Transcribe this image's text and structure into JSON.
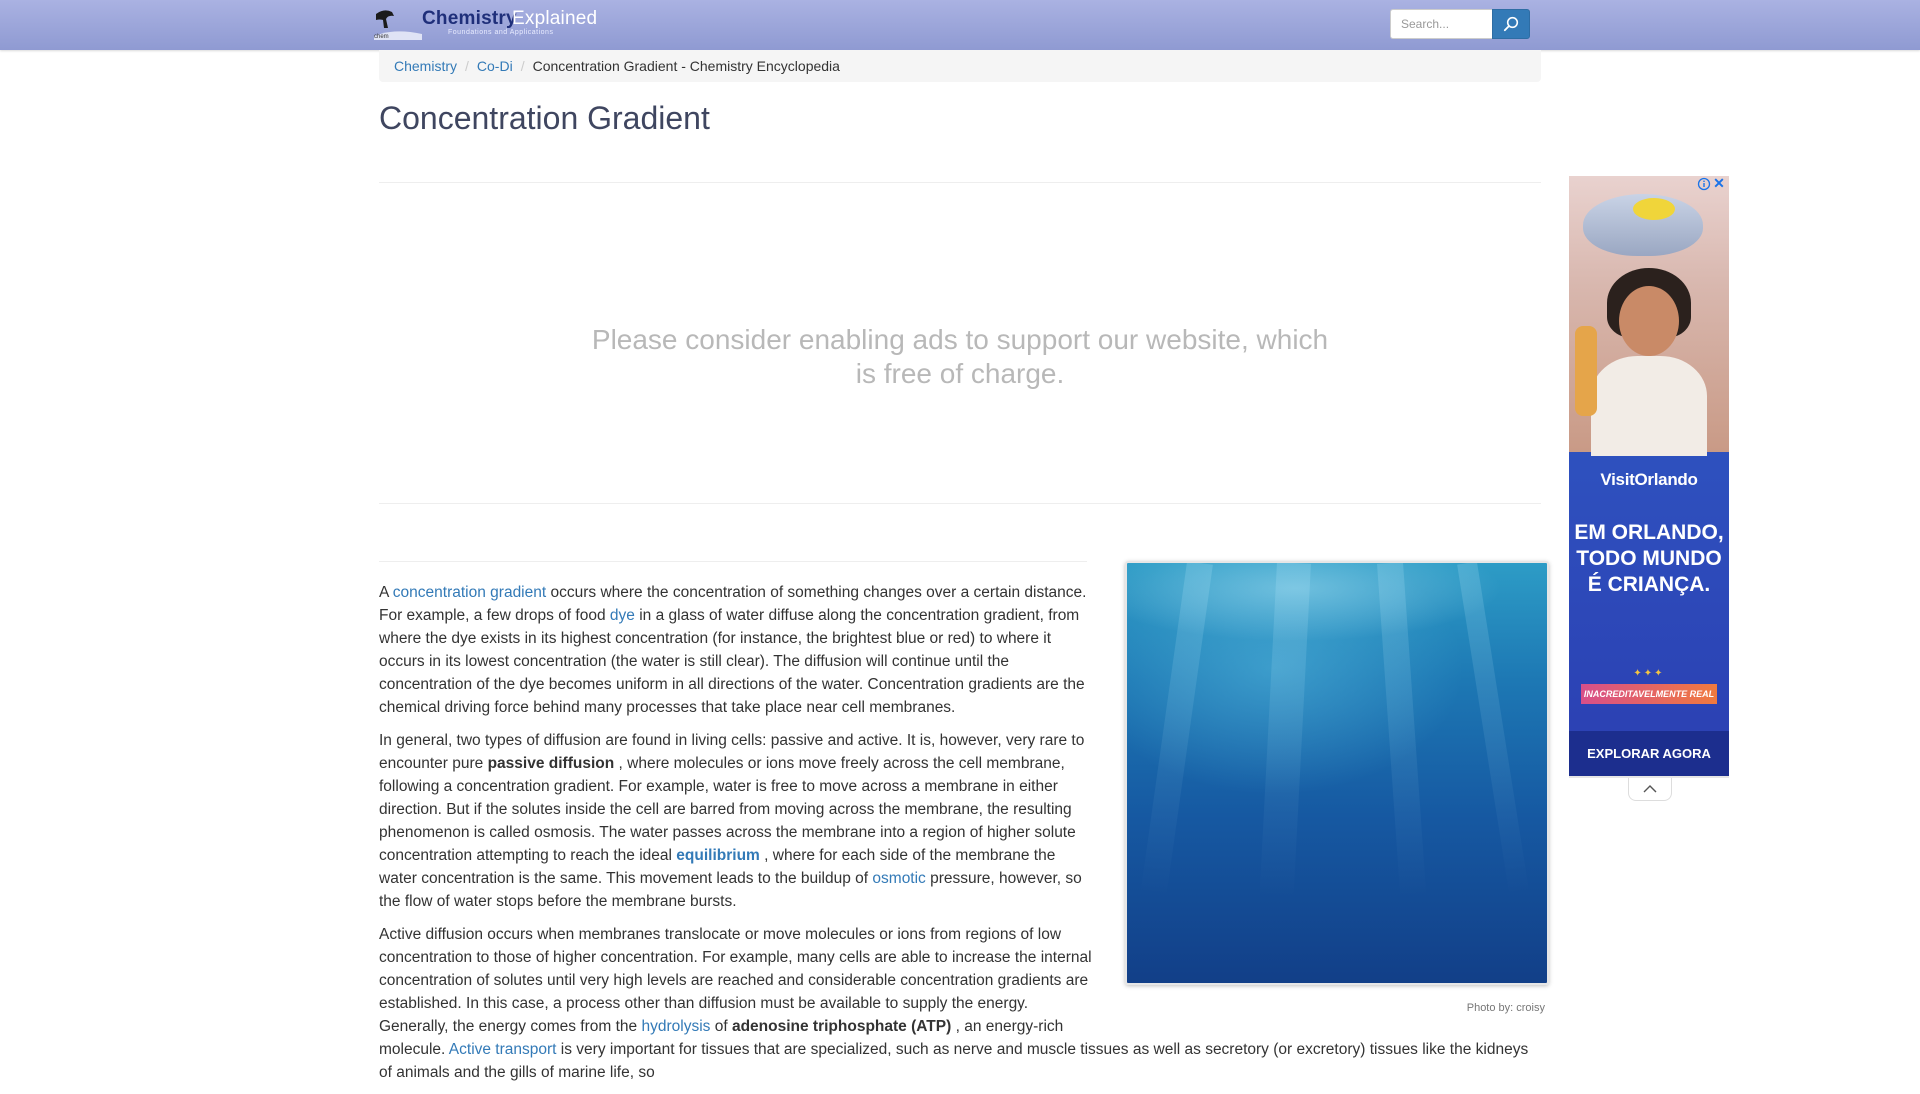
{
  "header": {
    "logo_main": "Chemistry",
    "logo_accent": "Explained",
    "logo_tagline": "Foundations and Applications",
    "search_placeholder": "Search...",
    "search_icon": "search-icon"
  },
  "breadcrumb": {
    "items": [
      "Chemistry",
      "Co-Di"
    ],
    "current": "Concentration Gradient - Chemistry Encyclopedia"
  },
  "page": {
    "title": "Concentration Gradient",
    "ad_notice": "Please consider enabling ads to support our website, which is free of charge."
  },
  "figure": {
    "credit": "Photo by: croisy"
  },
  "article": {
    "p1": {
      "t1": "A",
      "l1": "concentration gradient",
      "t2": "occurs where the concentration of something changes over a certain distance. For example, a few drops of food",
      "l2": "dye",
      "t3": "in a glass of water diffuse along the concentration gradient, from where the dye exists in its highest concentration (for instance, the brightest blue or red) to where it occurs in its lowest concentration (the water is still clear). The diffusion will continue until the concentration of the dye becomes uniform in all directions of the water. Concentration gradients are the chemical driving force behind many processes that take place near cell membranes."
    },
    "p2": {
      "t1": "In general, two types of diffusion are found in living cells: passive and active. It is, however, very rare to encounter pure",
      "b1": "passive diffusion",
      "t2": ", where molecules or ions move freely across the cell membrane, following a concentration gradient. For example, water is free to move across a membrane in either direction. But if the solutes inside the cell are barred from moving across the membrane, the resulting phenomenon is called osmosis. The water passes across the membrane into a region of higher solute concentration attempting to reach the ideal",
      "bl1": "equilibrium",
      "t3": ", where for each side of the membrane the water concentration is the same. This movement leads to the buildup of",
      "l1": "osmotic",
      "t4": "pressure, however, so the flow of water stops before the membrane bursts."
    },
    "p3": {
      "t1": "Active diffusion occurs when membranes translocate or move molecules or ions from regions of low concentration to those of higher concentration. For example, many cells are able to increase the internal concentration of solutes until very high levels are reached and considerable concentration gradients are established. In this case, a process other than diffusion must be available to supply the energy. Generally, the energy comes from the",
      "l1": "hydrolysis",
      "t2": "of",
      "b1": "adenosine triphosphate (ATP)",
      "t3": ", an energy-rich molecule.",
      "l2": "Active transport",
      "t4": "is very important for tissues that are specialized, such as nerve and muscle tissues as well as secretory (or excretory) tissues like the kidneys of animals and the gills of marine life, so"
    }
  },
  "side_ad": {
    "brand": "VisitOrlando",
    "headline": "EM ORLANDO, TODO MUNDO É CRIANÇA.",
    "ribbon": "INACREDITAVELMENTE REAL",
    "cta": "EXPLORAR AGORA",
    "close_symbol": "✕"
  }
}
